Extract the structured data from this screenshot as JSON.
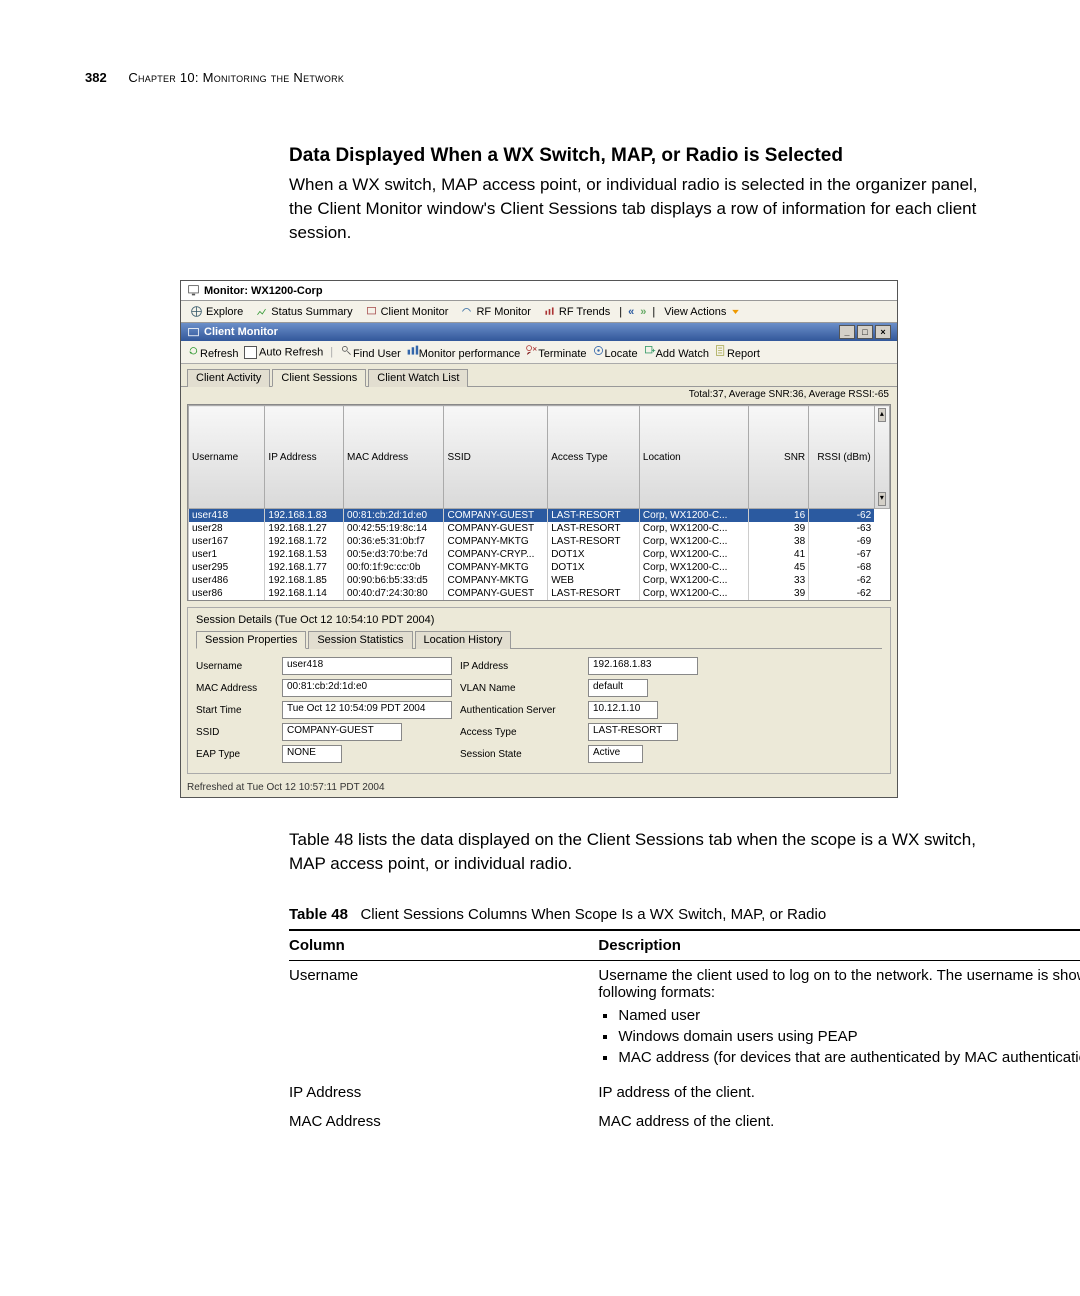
{
  "page": {
    "number": "382",
    "chapter": "Chapter 10: Monitoring the Network"
  },
  "section": {
    "title": "Data Displayed When a WX Switch, MAP, or Radio is Selected",
    "body": "When a WX switch, MAP access point, or individual radio is selected in the organizer panel, the Client Monitor window's Client Sessions tab displays a row of information for each client session."
  },
  "screenshot": {
    "window_title": "Monitor: WX1200-Corp",
    "top_tabs": [
      "Explore",
      "Status Summary",
      "Client Monitor",
      "RF Monitor",
      "RF Trends"
    ],
    "nav": {
      "view_actions": "View Actions"
    },
    "panel_title": "Client Monitor",
    "actions": {
      "refresh": "Refresh",
      "auto_refresh": "Auto Refresh",
      "find_user": "Find User",
      "monitor_perf": "Monitor performance",
      "terminate": "Terminate",
      "locate": "Locate",
      "add_watch": "Add Watch",
      "report": "Report"
    },
    "session_tabs": [
      "Client Activity",
      "Client Sessions",
      "Client Watch List"
    ],
    "stats_line": "Total:37, Average SNR:36, Average RSSI:-65",
    "columns": [
      "Username",
      "IP Address",
      "MAC Address",
      "SSID",
      "Access Type",
      "Location",
      "SNR",
      "RSSI (dBm)"
    ],
    "rows": [
      {
        "username": "user418",
        "ip": "192.168.1.83",
        "mac": "00:81:cb:2d:1d:e0",
        "ssid": "COMPANY-GUEST",
        "access": "LAST-RESORT",
        "loc": "Corp, WX1200-C...",
        "snr": "16",
        "rssi": "-62",
        "selected": true
      },
      {
        "username": "user28",
        "ip": "192.168.1.27",
        "mac": "00:42:55:19:8c:14",
        "ssid": "COMPANY-GUEST",
        "access": "LAST-RESORT",
        "loc": "Corp, WX1200-C...",
        "snr": "39",
        "rssi": "-63"
      },
      {
        "username": "user167",
        "ip": "192.168.1.72",
        "mac": "00:36:e5:31:0b:f7",
        "ssid": "COMPANY-MKTG",
        "access": "LAST-RESORT",
        "loc": "Corp, WX1200-C...",
        "snr": "38",
        "rssi": "-69"
      },
      {
        "username": "user1",
        "ip": "192.168.1.53",
        "mac": "00:5e:d3:70:be:7d",
        "ssid": "COMPANY-CRYP...",
        "access": "DOT1X",
        "loc": "Corp, WX1200-C...",
        "snr": "41",
        "rssi": "-67"
      },
      {
        "username": "user295",
        "ip": "192.168.1.77",
        "mac": "00:f0:1f:9c:cc:0b",
        "ssid": "COMPANY-MKTG",
        "access": "DOT1X",
        "loc": "Corp, WX1200-C...",
        "snr": "45",
        "rssi": "-68"
      },
      {
        "username": "user486",
        "ip": "192.168.1.85",
        "mac": "00:90:b6:b5:33:d5",
        "ssid": "COMPANY-MKTG",
        "access": "WEB",
        "loc": "Corp, WX1200-C...",
        "snr": "33",
        "rssi": "-62"
      },
      {
        "username": "user86",
        "ip": "192.168.1.14",
        "mac": "00:40:d7:24:30:80",
        "ssid": "COMPANY-GUEST",
        "access": "LAST-RESORT",
        "loc": "Corp, WX1200-C...",
        "snr": "39",
        "rssi": "-62"
      }
    ],
    "details": {
      "heading": "Session Details (Tue Oct 12 10:54:10 PDT 2004)",
      "tabs": [
        "Session Properties",
        "Session Statistics",
        "Location History"
      ],
      "fields": {
        "username_lbl": "Username",
        "username_val": "user418",
        "ip_lbl": "IP Address",
        "ip_val": "192.168.1.83",
        "mac_lbl": "MAC Address",
        "mac_val": "00:81:cb:2d:1d:e0",
        "vlan_lbl": "VLAN Name",
        "vlan_val": "default",
        "start_lbl": "Start Time",
        "start_val": "Tue Oct 12 10:54:09 PDT 2004",
        "auth_lbl": "Authentication Server",
        "auth_val": "10.12.1.10",
        "ssid_lbl": "SSID",
        "ssid_val": "COMPANY-GUEST",
        "access_lbl": "Access Type",
        "access_val": "LAST-RESORT",
        "eap_lbl": "EAP Type",
        "eap_val": "NONE",
        "state_lbl": "Session State",
        "state_val": "Active"
      }
    },
    "footer": "Refreshed at Tue Oct 12 10:57:11 PDT 2004"
  },
  "after_text": "Table 48 lists the data displayed on the Client Sessions tab when the scope is a WX switch, MAP access point, or individual radio.",
  "table48": {
    "label": "Table 48",
    "caption": "Client Sessions Columns When Scope Is a WX Switch, MAP, or Radio",
    "head_col": "Column",
    "head_desc": "Description",
    "rows": {
      "username_col": "Username",
      "username_desc": "Username the client used to log on to the network. The username is shown in one of the following formats:",
      "bullets": [
        "Named user",
        "Windows domain users using PEAP",
        "MAC address (for devices that are authenticated by MAC authentication)"
      ],
      "ip_col": "IP Address",
      "ip_desc": "IP address of the client.",
      "mac_col": "MAC Address",
      "mac_desc": "MAC address of the client."
    }
  }
}
